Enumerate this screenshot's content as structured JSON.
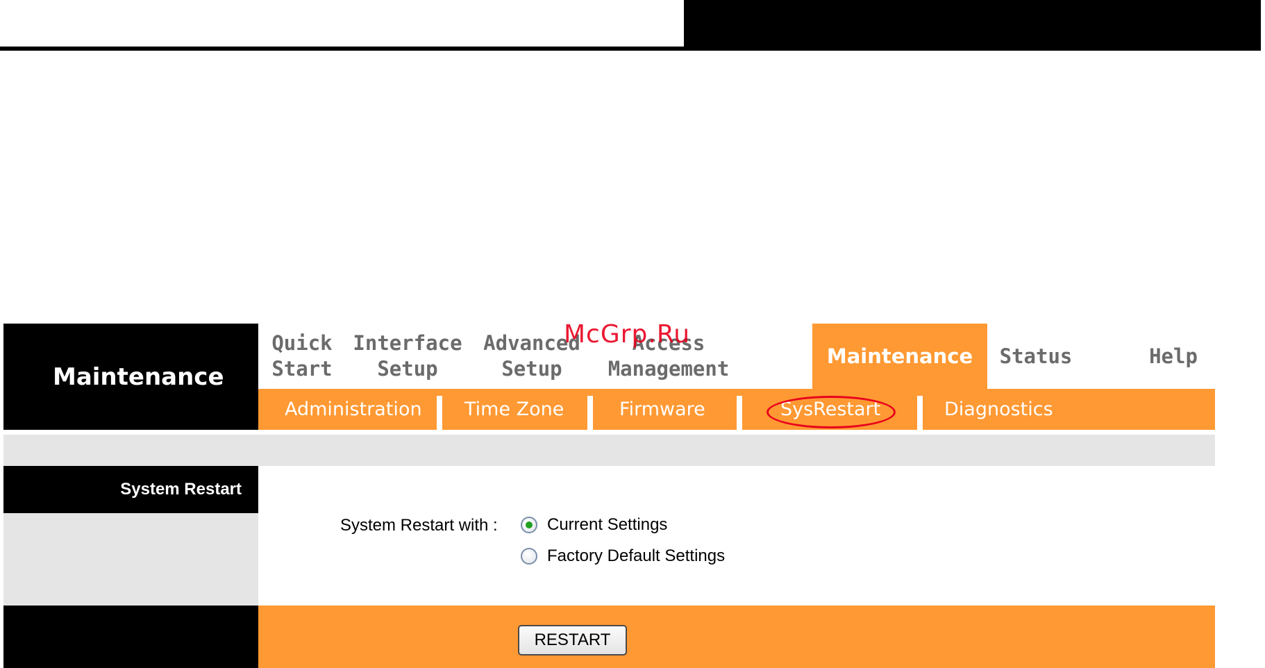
{
  "section_title": "Maintenance",
  "main_nav": [
    {
      "label": "Quick\nStart",
      "active": false
    },
    {
      "label": "Interface\nSetup",
      "active": false
    },
    {
      "label": "Advanced\nSetup",
      "active": false
    },
    {
      "label": "Access\nManagement",
      "active": false
    },
    {
      "label": "Maintenance",
      "active": true
    },
    {
      "label": "Status",
      "active": false
    },
    {
      "label": "Help",
      "active": false
    }
  ],
  "sub_nav": [
    {
      "label": "Administration"
    },
    {
      "label": "Time Zone"
    },
    {
      "label": "Firmware"
    },
    {
      "label": "SysRestart",
      "highlighted": true
    },
    {
      "label": "Diagnostics"
    }
  ],
  "panel": {
    "row_label": "System Restart",
    "form_label": "System Restart with :",
    "options": [
      {
        "label": "Current Settings",
        "checked": true
      },
      {
        "label": "Factory Default Settings",
        "checked": false
      }
    ],
    "restart_button": "RESTART"
  },
  "watermark": "McGrp.Ru",
  "colors": {
    "accent_orange": "#ff9933",
    "highlight_red": "#e8001c",
    "header_black": "#000000",
    "band_gray": "#e5e5e5"
  }
}
